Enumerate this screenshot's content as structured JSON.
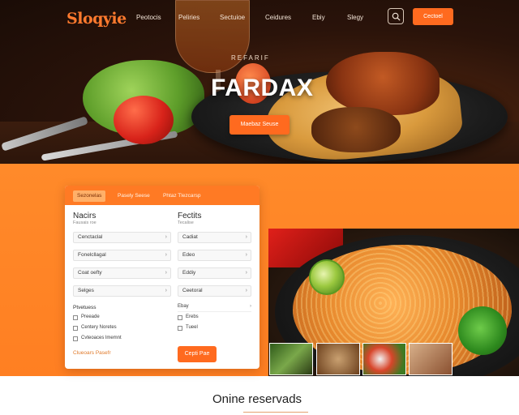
{
  "nav": {
    "logo": "Sloqyie",
    "logo_tagline": "",
    "links": [
      "Peotocis",
      "Peliries",
      "Sectuioe",
      "Ceidures",
      "Ebiy",
      "Slegy"
    ],
    "cta": "Cectoel"
  },
  "hero": {
    "kicker": "REFARIF",
    "title": "FARDAX",
    "button": "Maebaz Seuse"
  },
  "form": {
    "tabs": [
      "Sezonelas",
      "Pasely Seese",
      "Phtaz Tlezcarsp"
    ],
    "left_col": {
      "heading": "Nacirs",
      "sub": "Fausais roe",
      "selects": [
        "Cenctaclal",
        "Fonelcllagal",
        "Coat oefty",
        "Selges"
      ]
    },
    "right_col": {
      "heading": "Fectits",
      "sub": "Tecalise",
      "selects": [
        "Cadiat",
        "Edeo",
        "Eddiy",
        "Ceetoral"
      ]
    },
    "section_label": "Ptvetuess",
    "checks": [
      "Preeade",
      "Centery Noretes",
      "Cvteoaces lmemnt"
    ],
    "right_rows": [
      "Ebay",
      "Erebs",
      "Tueel"
    ],
    "foot_note": "Clueoars Pasefr",
    "submit": "Cepti Pae"
  },
  "section": {
    "title": "Onine reservads"
  },
  "colors": {
    "accent": "#ff6a1f",
    "band": "#ff8a2a"
  }
}
